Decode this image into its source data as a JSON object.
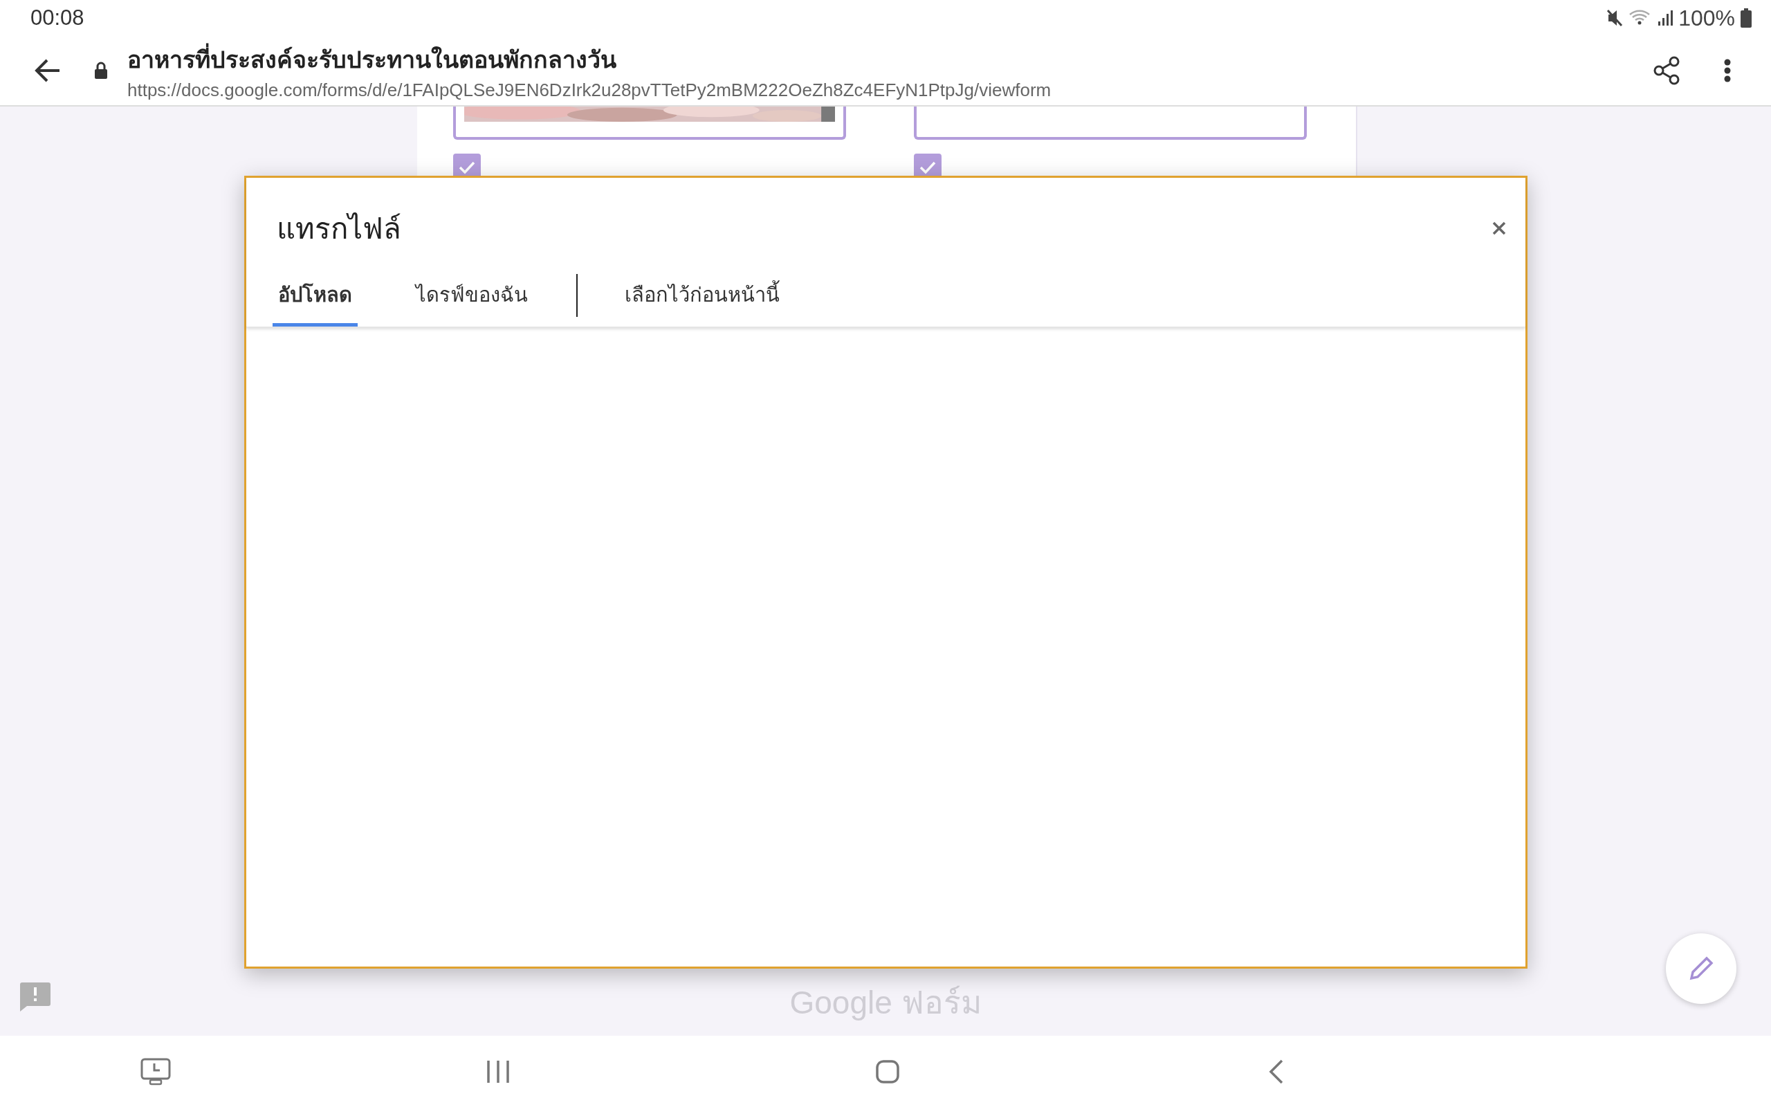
{
  "status_bar": {
    "time": "00:08",
    "battery": "100%"
  },
  "address_bar": {
    "title": "อาหารที่ประสงค์จะรับประทานในตอนพักกลางวัน",
    "url": "https://docs.google.com/forms/d/e/1FAIpQLSeJ9EN6DzIrk2u28pvTTetPy2mBM222OeZh8Zc4EFyN1PtpJg/viewform"
  },
  "form": {
    "options": [
      {
        "checked": true
      },
      {
        "checked": true
      }
    ]
  },
  "dialog": {
    "title": "แทรกไฟล์",
    "tabs": [
      {
        "label": "อัปโหลด",
        "selected": true
      },
      {
        "label": "ไดรฟ์ของฉัน",
        "selected": false
      },
      {
        "label": "เลือกไว้ก่อนหน้านี้",
        "selected": false
      }
    ]
  },
  "footer": {
    "brand": "Google ฟอร์ม"
  }
}
